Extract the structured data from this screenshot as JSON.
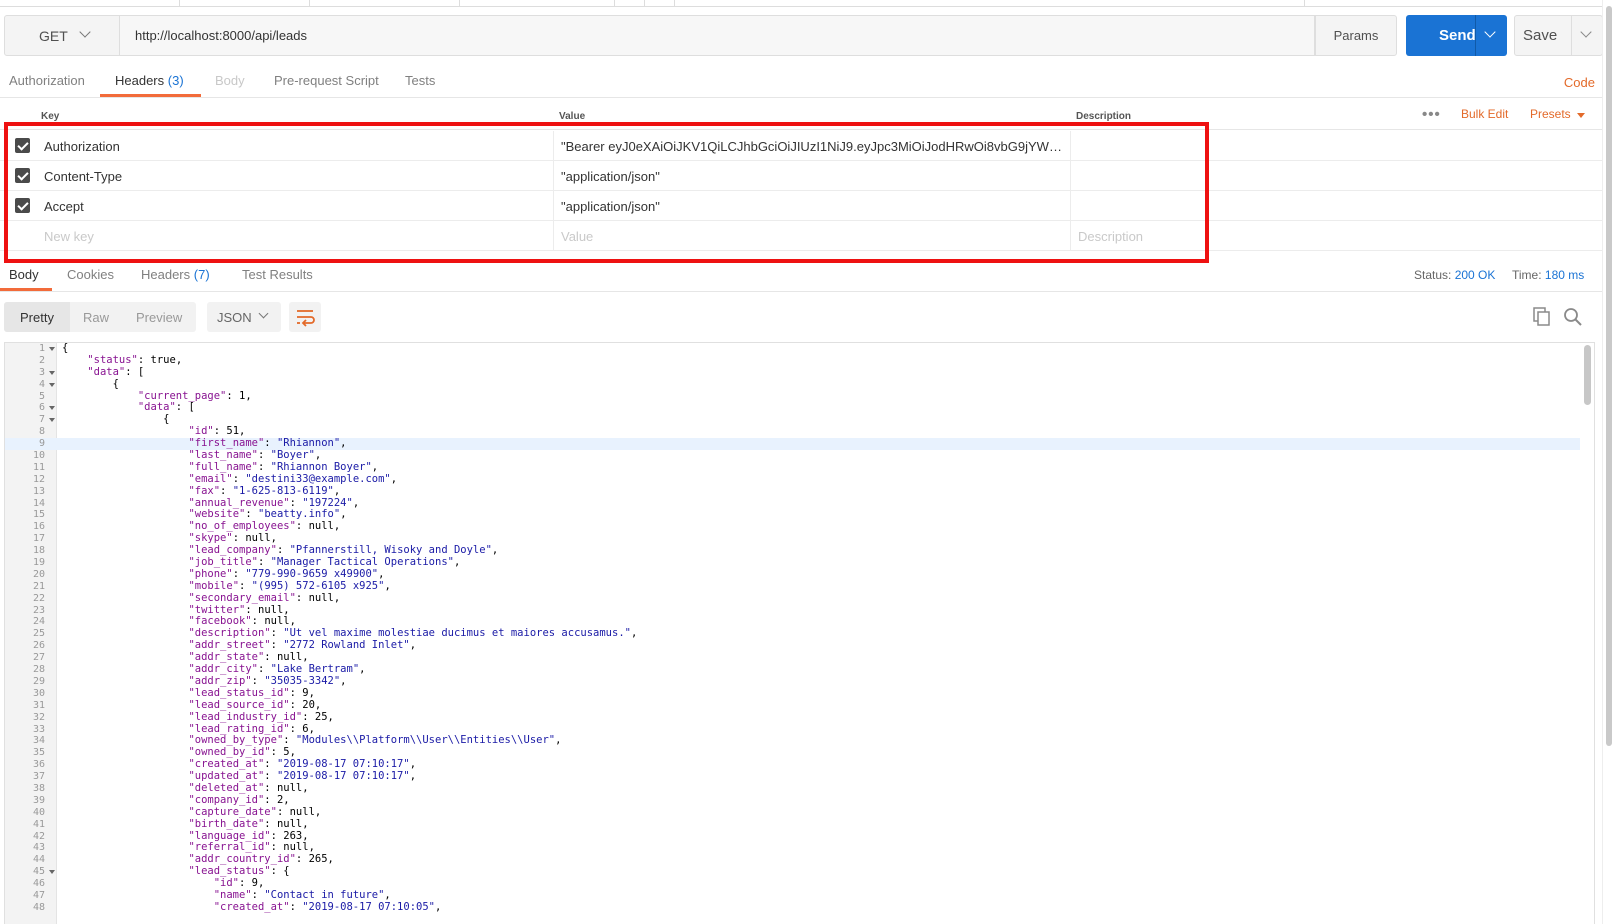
{
  "request": {
    "method": "GET",
    "url": "http://localhost:8000/api/leads",
    "params_label": "Params",
    "send_label": "Send",
    "save_label": "Save"
  },
  "request_tabs": [
    {
      "label": "Authorization"
    },
    {
      "label": "Headers",
      "count": "(3)"
    },
    {
      "label": "Body"
    },
    {
      "label": "Pre-request Script"
    },
    {
      "label": "Tests"
    }
  ],
  "code_label": "Code",
  "headers_table": {
    "columns": [
      "Key",
      "Value",
      "Description"
    ],
    "bulk_edit_label": "Bulk Edit",
    "presets_label": "Presets",
    "rows": [
      {
        "checked": true,
        "key": "Authorization",
        "value": "\"Bearer eyJ0eXAiOiJKV1QiLCJhbGciOiJIUzI1NiJ9.eyJpc3MiOiJodHRwOi8vbG9jYWxob3N0Oj...",
        "description": ""
      },
      {
        "checked": true,
        "key": "Content-Type",
        "value": "\"application/json\"",
        "description": ""
      },
      {
        "checked": true,
        "key": "Accept",
        "value": "\"application/json\"",
        "description": ""
      }
    ],
    "placeholder": {
      "key": "New key",
      "value": "Value",
      "description": "Description"
    }
  },
  "response_tabs": [
    {
      "label": "Body"
    },
    {
      "label": "Cookies"
    },
    {
      "label": "Headers",
      "count": "(7)"
    },
    {
      "label": "Test Results"
    }
  ],
  "response_status": {
    "status_label": "Status:",
    "status_value": "200 OK",
    "time_label": "Time:",
    "time_value": "180 ms"
  },
  "view_modes": [
    "Pretty",
    "Raw",
    "Preview"
  ],
  "format": "JSON",
  "highlighted_line": 9,
  "code_lines": [
    {
      "n": 1,
      "fold": true,
      "indent": 0,
      "text": "{"
    },
    {
      "n": 2,
      "indent": 1,
      "k": "status",
      "v": "true",
      "t": "n"
    },
    {
      "n": 3,
      "fold": true,
      "indent": 1,
      "k": "data",
      "raw": "["
    },
    {
      "n": 4,
      "fold": true,
      "indent": 2,
      "text": "{"
    },
    {
      "n": 5,
      "indent": 3,
      "k": "current_page",
      "v": "1",
      "t": "n"
    },
    {
      "n": 6,
      "fold": true,
      "indent": 3,
      "k": "data",
      "raw": "["
    },
    {
      "n": 7,
      "fold": true,
      "indent": 4,
      "text": "{"
    },
    {
      "n": 8,
      "indent": 5,
      "k": "id",
      "v": "51",
      "t": "n"
    },
    {
      "n": 9,
      "indent": 5,
      "k": "first_name",
      "v": "\"Rhiannon\"",
      "t": "s"
    },
    {
      "n": 10,
      "indent": 5,
      "k": "last_name",
      "v": "\"Boyer\"",
      "t": "s"
    },
    {
      "n": 11,
      "indent": 5,
      "k": "full_name",
      "v": "\"Rhiannon Boyer\"",
      "t": "s"
    },
    {
      "n": 12,
      "indent": 5,
      "k": "email",
      "v": "\"destini33@example.com\"",
      "t": "s"
    },
    {
      "n": 13,
      "indent": 5,
      "k": "fax",
      "v": "\"1-625-813-6119\"",
      "t": "s"
    },
    {
      "n": 14,
      "indent": 5,
      "k": "annual_revenue",
      "v": "\"197224\"",
      "t": "s"
    },
    {
      "n": 15,
      "indent": 5,
      "k": "website",
      "v": "\"beatty.info\"",
      "t": "s"
    },
    {
      "n": 16,
      "indent": 5,
      "k": "no_of_employees",
      "v": "null",
      "t": "n"
    },
    {
      "n": 17,
      "indent": 5,
      "k": "skype",
      "v": "null",
      "t": "n"
    },
    {
      "n": 18,
      "indent": 5,
      "k": "lead_company",
      "v": "\"Pfannerstill, Wisoky and Doyle\"",
      "t": "s"
    },
    {
      "n": 19,
      "indent": 5,
      "k": "job_title",
      "v": "\"Manager Tactical Operations\"",
      "t": "s"
    },
    {
      "n": 20,
      "indent": 5,
      "k": "phone",
      "v": "\"779-990-9659 x49900\"",
      "t": "s"
    },
    {
      "n": 21,
      "indent": 5,
      "k": "mobile",
      "v": "\"(995) 572-6105 x925\"",
      "t": "s"
    },
    {
      "n": 22,
      "indent": 5,
      "k": "secondary_email",
      "v": "null",
      "t": "n"
    },
    {
      "n": 23,
      "indent": 5,
      "k": "twitter",
      "v": "null",
      "t": "n"
    },
    {
      "n": 24,
      "indent": 5,
      "k": "facebook",
      "v": "null",
      "t": "n"
    },
    {
      "n": 25,
      "indent": 5,
      "k": "description",
      "v": "\"Ut vel maxime molestiae ducimus et maiores accusamus.\"",
      "t": "s"
    },
    {
      "n": 26,
      "indent": 5,
      "k": "addr_street",
      "v": "\"2772 Rowland Inlet\"",
      "t": "s"
    },
    {
      "n": 27,
      "indent": 5,
      "k": "addr_state",
      "v": "null",
      "t": "n"
    },
    {
      "n": 28,
      "indent": 5,
      "k": "addr_city",
      "v": "\"Lake Bertram\"",
      "t": "s"
    },
    {
      "n": 29,
      "indent": 5,
      "k": "addr_zip",
      "v": "\"35035-3342\"",
      "t": "s"
    },
    {
      "n": 30,
      "indent": 5,
      "k": "lead_status_id",
      "v": "9",
      "t": "n"
    },
    {
      "n": 31,
      "indent": 5,
      "k": "lead_source_id",
      "v": "20",
      "t": "n"
    },
    {
      "n": 32,
      "indent": 5,
      "k": "lead_industry_id",
      "v": "25",
      "t": "n"
    },
    {
      "n": 33,
      "indent": 5,
      "k": "lead_rating_id",
      "v": "6",
      "t": "n"
    },
    {
      "n": 34,
      "indent": 5,
      "k": "owned_by_type",
      "v": "\"Modules\\\\Platform\\\\User\\\\Entities\\\\User\"",
      "t": "s"
    },
    {
      "n": 35,
      "indent": 5,
      "k": "owned_by_id",
      "v": "5",
      "t": "n"
    },
    {
      "n": 36,
      "indent": 5,
      "k": "created_at",
      "v": "\"2019-08-17 07:10:17\"",
      "t": "s"
    },
    {
      "n": 37,
      "indent": 5,
      "k": "updated_at",
      "v": "\"2019-08-17 07:10:17\"",
      "t": "s"
    },
    {
      "n": 38,
      "indent": 5,
      "k": "deleted_at",
      "v": "null",
      "t": "n"
    },
    {
      "n": 39,
      "indent": 5,
      "k": "company_id",
      "v": "2",
      "t": "n"
    },
    {
      "n": 40,
      "indent": 5,
      "k": "capture_date",
      "v": "null",
      "t": "n"
    },
    {
      "n": 41,
      "indent": 5,
      "k": "birth_date",
      "v": "null",
      "t": "n"
    },
    {
      "n": 42,
      "indent": 5,
      "k": "language_id",
      "v": "263",
      "t": "n"
    },
    {
      "n": 43,
      "indent": 5,
      "k": "referral_id",
      "v": "null",
      "t": "n"
    },
    {
      "n": 44,
      "indent": 5,
      "k": "addr_country_id",
      "v": "265",
      "t": "n"
    },
    {
      "n": 45,
      "fold": true,
      "indent": 5,
      "k": "lead_status",
      "raw": "{"
    },
    {
      "n": 46,
      "indent": 6,
      "k": "id",
      "v": "9",
      "t": "n"
    },
    {
      "n": 47,
      "indent": 6,
      "k": "name",
      "v": "\"Contact in future\"",
      "t": "s"
    },
    {
      "n": 48,
      "indent": 6,
      "k": "created_at",
      "v": "\"2019-08-17 07:10:05\"",
      "t": "s"
    }
  ]
}
